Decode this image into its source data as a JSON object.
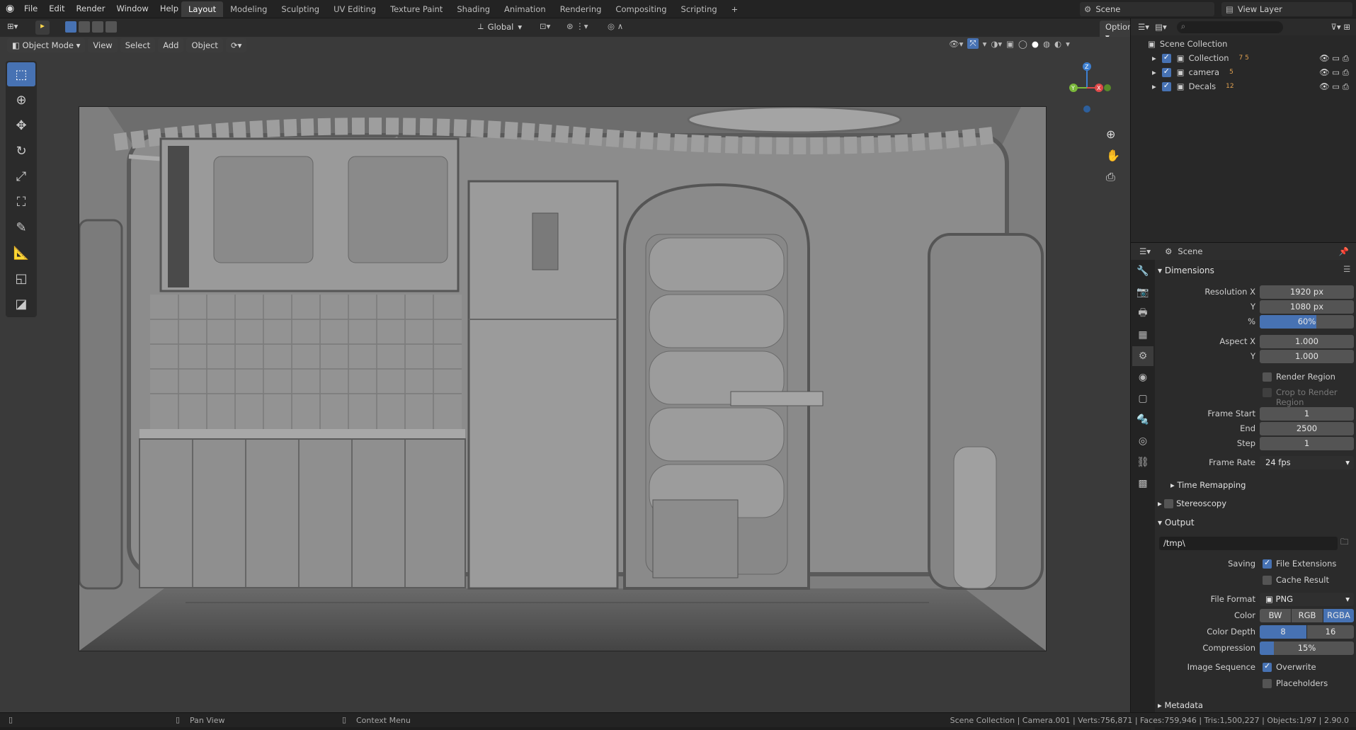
{
  "menu": {
    "items": [
      "File",
      "Edit",
      "Render",
      "Window",
      "Help"
    ]
  },
  "workspaces": [
    "Layout",
    "Modeling",
    "Sculpting",
    "UV Editing",
    "Texture Paint",
    "Shading",
    "Animation",
    "Rendering",
    "Compositing",
    "Scripting",
    "+"
  ],
  "scene_selector": {
    "label": "Scene"
  },
  "view_layer": {
    "label": "View Layer"
  },
  "header2": {
    "transform_orientation": "Global",
    "options": "Options"
  },
  "viewport_header": {
    "mode": "Object Mode",
    "view": "View",
    "select": "Select",
    "add": "Add",
    "object": "Object"
  },
  "outliner": {
    "root": "Scene Collection",
    "items": [
      {
        "name": "Collection",
        "badge": "7 5"
      },
      {
        "name": "camera",
        "badge": "5"
      },
      {
        "name": "Decals",
        "badge": "12"
      }
    ]
  },
  "properties": {
    "header": "Scene",
    "dimensions": {
      "title": "Dimensions",
      "resolution_x_label": "Resolution X",
      "resolution_x": "1920 px",
      "y_label": "Y",
      "resolution_y": "1080 px",
      "pct_label": "%",
      "resolution_pct": "60%",
      "resolution_fraction": 0.6,
      "aspect_x_label": "Aspect X",
      "aspect_x": "1.000",
      "aspect_y_label": "Y",
      "aspect_y": "1.000",
      "render_region": "Render Region",
      "crop": "Crop to Render Region",
      "frame_start_label": "Frame Start",
      "frame_start": "1",
      "end_label": "End",
      "frame_end": "2500",
      "step_label": "Step",
      "frame_step": "1",
      "frame_rate_label": "Frame Rate",
      "frame_rate": "24 fps",
      "time_remapping": "Time Remapping"
    },
    "stereoscopy": "Stereoscopy",
    "output": {
      "title": "Output",
      "path": "/tmp\\",
      "saving_label": "Saving",
      "file_extensions": "File Extensions",
      "cache_result": "Cache Result",
      "file_format_label": "File Format",
      "file_format": "PNG",
      "color_label": "Color",
      "color_bw": "BW",
      "color_rgb": "RGB",
      "color_rgba": "RGBA",
      "color_depth_label": "Color Depth",
      "depth_8": "8",
      "depth_16": "16",
      "compression_label": "Compression",
      "compression": "15%",
      "compression_fraction": 0.15,
      "image_sequence_label": "Image Sequence",
      "overwrite": "Overwrite",
      "placeholders": "Placeholders"
    },
    "metadata": "Metadata"
  },
  "status": {
    "pan": "Pan View",
    "context": "Context Menu",
    "stats": "Scene Collection | Camera.001 | Verts:756,871 | Faces:759,946 | Tris:1,500,227 | Objects:1/97 | 2.90.0"
  },
  "colors": {
    "accent": "#4772b3",
    "axis_x": "#e04a4a",
    "axis_y": "#7ab83a",
    "axis_z": "#3d7fd1"
  }
}
